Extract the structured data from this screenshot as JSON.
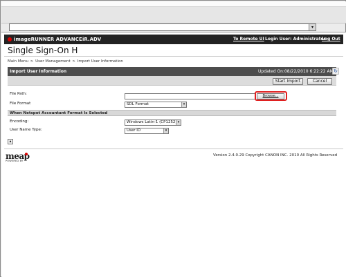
{
  "app": {
    "product_name": "imageRUNNER ADVANCE",
    "device_name": "iR.ADV",
    "remote_ui_link": "To Remote UI",
    "login_user": "Login User: Administrator",
    "logout": "Log Out",
    "title": "Single Sign-On H"
  },
  "breadcrumb": {
    "items": [
      "Main Menu",
      "User Management",
      "Import User Information"
    ],
    "separator": ">"
  },
  "section": {
    "title": "Import User Information",
    "updated_text": "Updated On:08/22/2010 6:22:22 AM"
  },
  "actions": {
    "start_import": "Start Import",
    "cancel": "Cancel"
  },
  "form": {
    "file_path_label": "File Path:",
    "file_path_value": "",
    "browse_label": "Browse...",
    "file_format_label": "File Format",
    "file_format_value": "SDL Format",
    "netspot_section_title": "When Netspot Accountant Format Is Selected",
    "encoding_label": "Encoding:",
    "encoding_value": "Windows Latin-1 (CP1252)",
    "user_name_type_label": "User Name Type:",
    "user_name_type_value": "User ID"
  },
  "footer": {
    "logo": "meap",
    "powered_by": "POWERED BY",
    "copyright": "Version 2.4.0.29 Copyright CANON INC. 2010 All Rights Reserved"
  },
  "colors": {
    "header_bg": "#232323",
    "section_header_bg": "#4d4d4d",
    "highlight_red": "#e02020",
    "logo_red": "#d80000"
  },
  "icons": {
    "refresh": "refresh-icon",
    "dropdown": "chevron-down-icon",
    "collapse": "collapse-icon"
  }
}
